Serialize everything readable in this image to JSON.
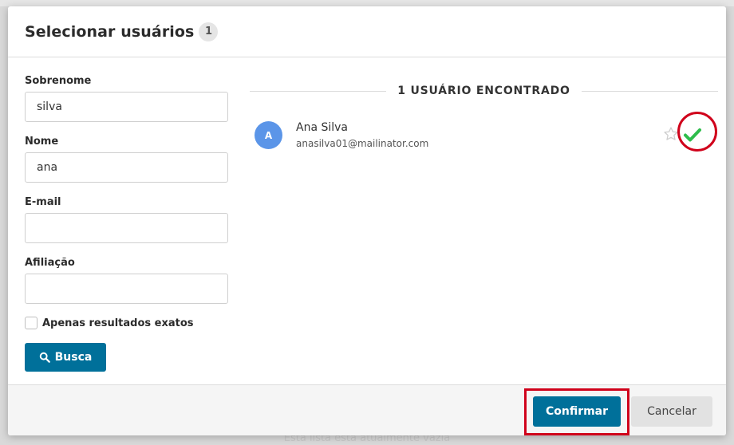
{
  "dialog": {
    "title": "Selecionar usuários",
    "count": "1"
  },
  "form": {
    "surname_label": "Sobrenome",
    "surname_value": "silva",
    "name_label": "Nome",
    "name_value": "ana",
    "email_label": "E-mail",
    "email_value": "",
    "affiliation_label": "Afiliação",
    "affiliation_value": "",
    "exact_label": "Apenas resultados exatos",
    "exact_checked": false,
    "search_label": "Busca"
  },
  "results": {
    "header": "1 USUÁRIO ENCONTRADO",
    "users": [
      {
        "initial": "A",
        "name": "Ana Silva",
        "email": "anasilva01@mailinator.com",
        "avatar_color": "#5b95e8",
        "selected": true
      }
    ]
  },
  "footer": {
    "confirm_label": "Confirmar",
    "cancel_label": "Cancelar"
  },
  "background": {
    "empty_list_text": "Esta lista está atualmente vazia"
  },
  "icons": {
    "search": "search-icon",
    "star": "star-icon",
    "check": "check-icon"
  },
  "colors": {
    "primary": "#00709a",
    "highlight": "#d0021b",
    "check": "#2ebd4c"
  }
}
